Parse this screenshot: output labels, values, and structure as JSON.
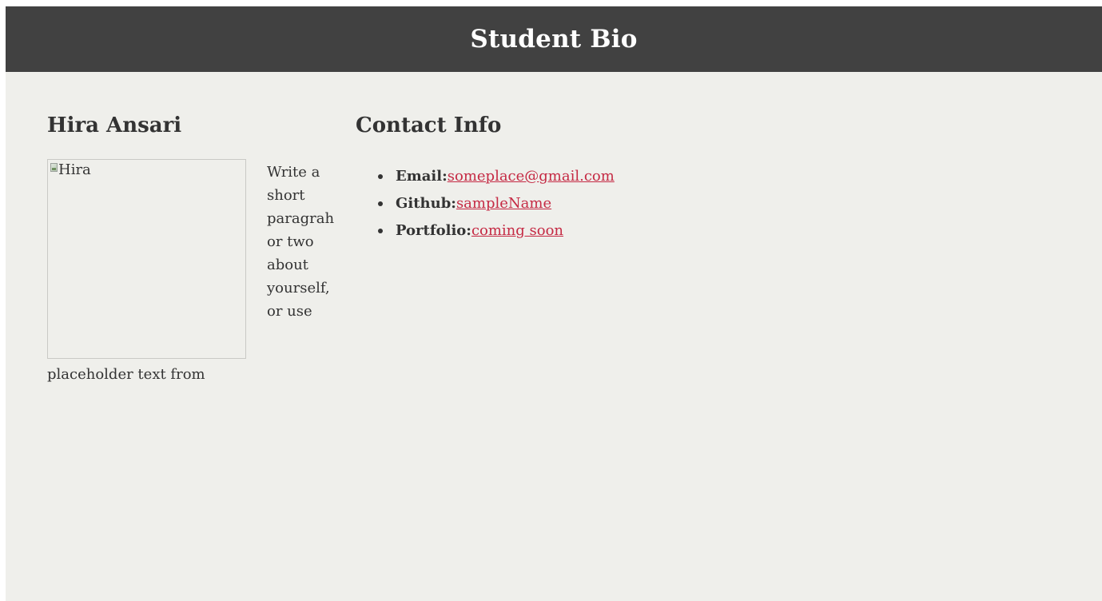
{
  "header": {
    "title": "Student Bio"
  },
  "bio": {
    "name": "Hira Ansari",
    "image_alt": "Hira",
    "paragraph_lines": "Write a\nshort\nparagrah\nor two\nabout\nyourself,\nor use",
    "paragraph_tail": "placeholder text from"
  },
  "contact": {
    "heading": "Contact Info",
    "items": [
      {
        "label": "Email:",
        "link_text": "someplace@gmail.com"
      },
      {
        "label": "Github:",
        "link_text": "sampleName"
      },
      {
        "label": "Portfolio:",
        "link_text": "coming soon"
      }
    ]
  },
  "colors": {
    "header_bg": "#414141",
    "page_bg": "#efefeb",
    "link": "#c52a44",
    "text": "#333333"
  }
}
